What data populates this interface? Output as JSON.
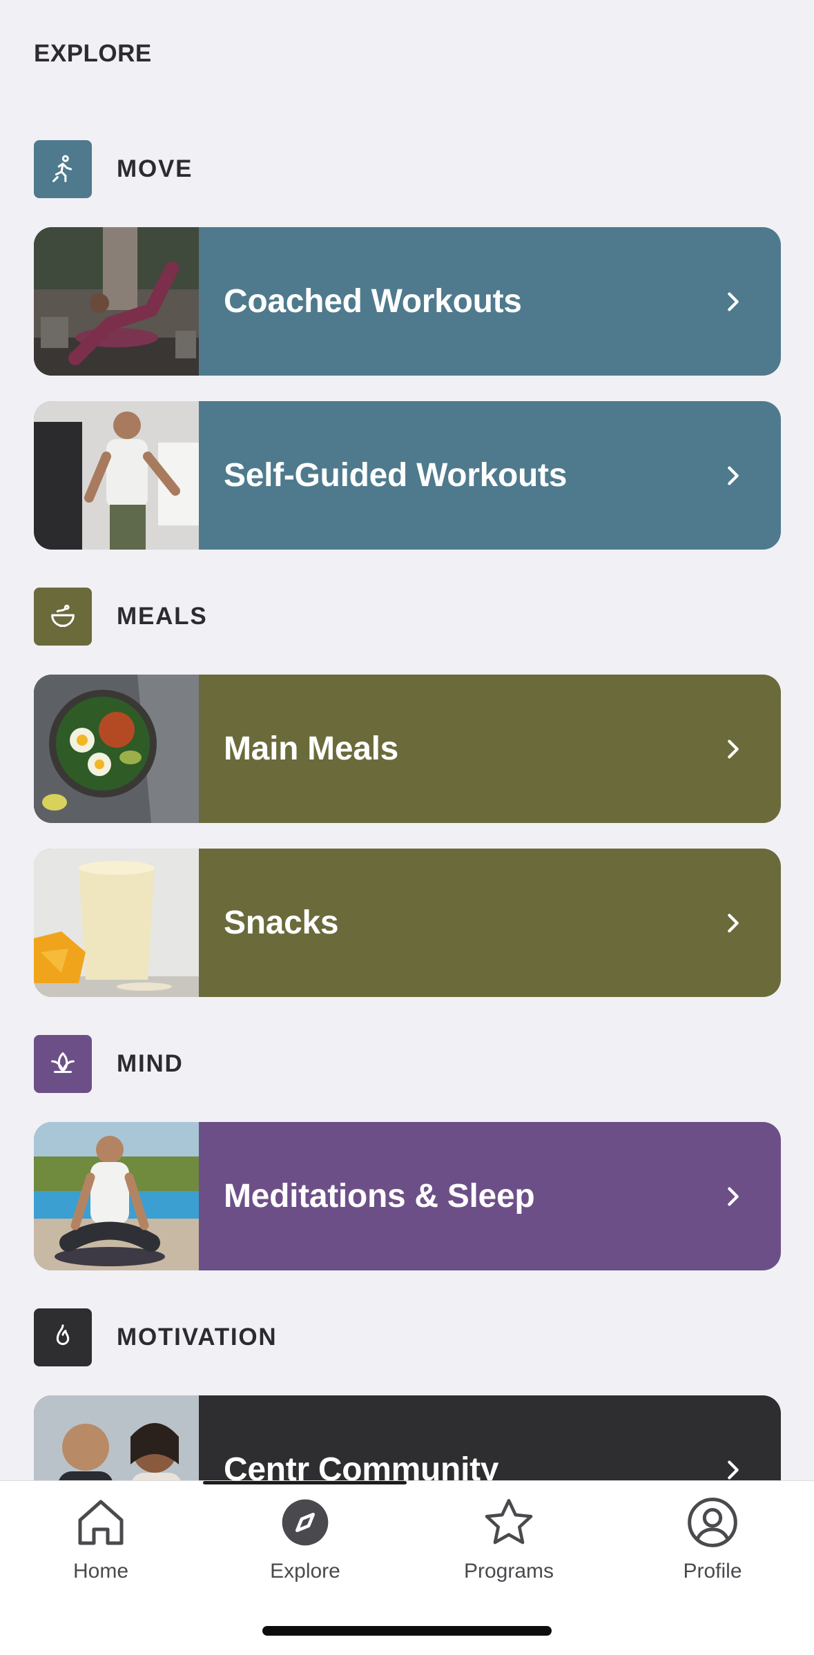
{
  "page": {
    "title": "EXPLORE"
  },
  "sections": {
    "move": {
      "label": "MOVE",
      "icon": "running-figure-icon",
      "color": "#4f7a8d",
      "cards": [
        {
          "title": "Coached Workouts",
          "image": "woman-floor-workout-photo"
        },
        {
          "title": "Self-Guided Workouts",
          "image": "man-cable-machine-photo"
        }
      ]
    },
    "meals": {
      "label": "MEALS",
      "icon": "bowl-icon",
      "color": "#6b6a3b",
      "cards": [
        {
          "title": "Main Meals",
          "image": "salad-bowl-photo"
        },
        {
          "title": "Snacks",
          "image": "smoothie-mango-photo"
        }
      ]
    },
    "mind": {
      "label": "MIND",
      "icon": "lotus-icon",
      "color": "#6d4f88",
      "cards": [
        {
          "title": "Meditations & Sleep",
          "image": "man-meditating-pool-photo"
        }
      ]
    },
    "motivation": {
      "label": "MOTIVATION",
      "icon": "flame-icon",
      "color": "#2e2d2f",
      "cards": [
        {
          "title": "Centr Community",
          "image": "two-people-smiling-photo"
        }
      ]
    }
  },
  "tabbar": {
    "active": "Explore",
    "tabs": [
      {
        "label": "Home",
        "icon": "home-icon"
      },
      {
        "label": "Explore",
        "icon": "compass-icon"
      },
      {
        "label": "Programs",
        "icon": "star-icon"
      },
      {
        "label": "Profile",
        "icon": "profile-icon"
      }
    ]
  }
}
